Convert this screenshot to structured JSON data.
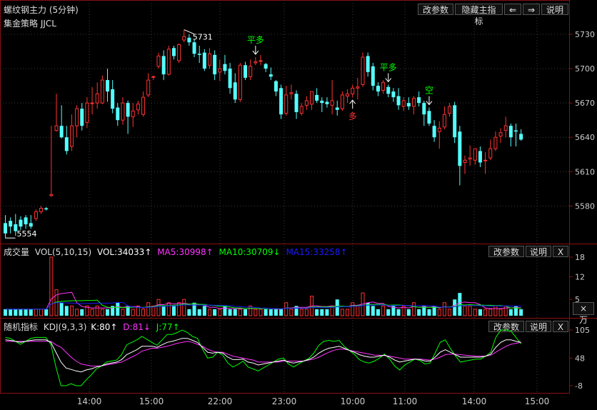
{
  "header": {
    "title": "螺纹钢主力 (5分钟)",
    "strategy": "集金策略 JJCL",
    "btn_params": "改参数",
    "btn_hide": "隐藏主指标",
    "btn_left": "⇐",
    "btn_right": "⇒",
    "btn_help": "说明"
  },
  "price_panel": {
    "y_ticks": [
      "5730",
      "5700",
      "5670",
      "5640",
      "5610",
      "5580"
    ],
    "high_label": "5731",
    "low_label": "5554",
    "signals": [
      {
        "label": "平多",
        "type": "close"
      },
      {
        "label": "多",
        "type": "long"
      },
      {
        "label": "平多",
        "type": "close"
      },
      {
        "label": "空",
        "type": "short"
      }
    ]
  },
  "volume_panel": {
    "name": "成交量",
    "vol": "VOL(5,10,15)",
    "vol_value": "VOL:34033↑",
    "ma5": "MA5:30998↑",
    "ma10": "MA10:30709↓",
    "ma15": "MA15:33258↑",
    "y_ticks": [
      "18",
      "12",
      "5"
    ],
    "unit": "×万",
    "btn_params": "改参数",
    "btn_help": "说明",
    "btn_close": "X"
  },
  "kdj_panel": {
    "name": "随机指标",
    "kdj": "KDJ(9,3,3)",
    "k": "K:80↑",
    "d": "D:81↓",
    "j": "J:77↑",
    "y_ticks": [
      "105",
      "48",
      "-8"
    ],
    "btn_params": "改参数",
    "btn_help": "说明",
    "btn_close": "X"
  },
  "x_axis": [
    "14:00",
    "15:00",
    "22:00",
    "23:00",
    "10:00",
    "11:00",
    "14:00",
    "15:00"
  ],
  "colors": {
    "up": "#ff3232",
    "down": "#54ffff",
    "ma5": "#ff33ff",
    "ma10": "#00ff00",
    "ma15": "#1a1aff",
    "signal_green": "#00ff00",
    "signal_red": "#ff3232"
  },
  "chart_data": {
    "type": "candlestick",
    "price_axis": [
      5554,
      5735
    ],
    "candles": [
      [
        5565,
        5572,
        5556,
        5552
      ],
      [
        5567,
        5570,
        5562,
        5556
      ],
      [
        5564,
        5573,
        5558,
        5554
      ],
      [
        5568,
        5571,
        5562,
        5559
      ],
      [
        5570,
        5572,
        5564,
        5560
      ],
      [
        5565,
        5572,
        5562,
        5560
      ],
      [
        5569,
        5577,
        5575,
        5567
      ],
      [
        5575,
        5580,
        5578,
        5573
      ],
      [
        5578,
        5579,
        5577,
        5576
      ],
      [
        5589,
        5650,
        5590,
        5588
      ],
      [
        5646,
        5678,
        5650,
        5645
      ],
      [
        5650,
        5668,
        5640,
        5639
      ],
      [
        5640,
        5650,
        5628,
        5625
      ],
      [
        5632,
        5660,
        5650,
        5628
      ],
      [
        5650,
        5668,
        5665,
        5640
      ],
      [
        5665,
        5670,
        5650,
        5646
      ],
      [
        5653,
        5675,
        5670,
        5648
      ],
      [
        5670,
        5684,
        5670,
        5660
      ],
      [
        5670,
        5688,
        5678,
        5665
      ],
      [
        5670,
        5694,
        5690,
        5669
      ],
      [
        5690,
        5700,
        5680,
        5671
      ],
      [
        5682,
        5690,
        5665,
        5661
      ],
      [
        5666,
        5670,
        5655,
        5650
      ],
      [
        5655,
        5675,
        5670,
        5651
      ],
      [
        5670,
        5672,
        5658,
        5643
      ],
      [
        5658,
        5670,
        5663,
        5649
      ],
      [
        5664,
        5672,
        5669,
        5660
      ],
      [
        5660,
        5680,
        5675,
        5658
      ],
      [
        5677,
        5696,
        5690,
        5675
      ],
      [
        5693,
        5694,
        5693,
        5690
      ],
      [
        5702,
        5714,
        5711,
        5700
      ],
      [
        5711,
        5716,
        5695,
        5690
      ],
      [
        5695,
        5720,
        5717,
        5694
      ],
      [
        5718,
        5720,
        5711,
        5708
      ],
      [
        5707,
        5722,
        5721,
        5705
      ],
      [
        5725,
        5734,
        5728,
        5723
      ],
      [
        5727,
        5730,
        5723,
        5720
      ],
      [
        5723,
        5726,
        5713,
        5710
      ],
      [
        5713,
        5720,
        5712,
        5705
      ],
      [
        5714,
        5717,
        5700,
        5698
      ],
      [
        5703,
        5718,
        5713,
        5700
      ],
      [
        5712,
        5716,
        5695,
        5690
      ],
      [
        5697,
        5708,
        5700,
        5689
      ],
      [
        5704,
        5712,
        5698,
        5695
      ],
      [
        5700,
        5705,
        5683,
        5678
      ],
      [
        5688,
        5696,
        5673,
        5670
      ],
      [
        5673,
        5705,
        5703,
        5671
      ],
      [
        5703,
        5706,
        5692,
        5690
      ],
      [
        5693,
        5708,
        5702,
        5690
      ],
      [
        5705,
        5710,
        5706,
        5703
      ],
      [
        5707,
        5712,
        5707,
        5703
      ],
      [
        5704,
        5705,
        5700,
        5697
      ],
      [
        5695,
        5701,
        5693,
        5690
      ],
      [
        5689,
        5690,
        5680,
        5676
      ],
      [
        5683,
        5686,
        5660,
        5656
      ],
      [
        5661,
        5685,
        5677,
        5659
      ],
      [
        5678,
        5686,
        5679,
        5673
      ],
      [
        5678,
        5681,
        5662,
        5656
      ],
      [
        5661,
        5670,
        5667,
        5659
      ],
      [
        5668,
        5676,
        5672,
        5664
      ],
      [
        5669,
        5678,
        5680,
        5664
      ],
      [
        5677,
        5683,
        5672,
        5670
      ],
      [
        5672,
        5675,
        5670,
        5662
      ],
      [
        5671,
        5675,
        5669,
        5666
      ],
      [
        5668,
        5690,
        5672,
        5660
      ],
      [
        5666,
        5672,
        5664,
        5659
      ],
      [
        5665,
        5680,
        5677,
        5663
      ],
      [
        5676,
        5682,
        5678,
        5670
      ],
      [
        5678,
        5686,
        5683,
        5675
      ],
      [
        5683,
        5692,
        5684,
        5673
      ],
      [
        5686,
        5714,
        5710,
        5684
      ],
      [
        5711,
        5714,
        5697,
        5693
      ],
      [
        5702,
        5705,
        5685,
        5681
      ],
      [
        5685,
        5688,
        5680,
        5676
      ],
      [
        5681,
        5690,
        5688,
        5678
      ],
      [
        5684,
        5686,
        5678,
        5675
      ],
      [
        5680,
        5683,
        5675,
        5671
      ],
      [
        5676,
        5683,
        5668,
        5664
      ],
      [
        5667,
        5675,
        5672,
        5663
      ],
      [
        5670,
        5675,
        5667,
        5664
      ],
      [
        5667,
        5676,
        5674,
        5660
      ],
      [
        5675,
        5680,
        5670,
        5667
      ],
      [
        5670,
        5672,
        5660,
        5650
      ],
      [
        5663,
        5666,
        5652,
        5650
      ],
      [
        5650,
        5655,
        5640,
        5636
      ],
      [
        5645,
        5654,
        5648,
        5630
      ],
      [
        5649,
        5667,
        5660,
        5647
      ],
      [
        5661,
        5670,
        5667,
        5658
      ],
      [
        5668,
        5671,
        5640,
        5635
      ],
      [
        5645,
        5650,
        5615,
        5598
      ],
      [
        5618,
        5624,
        5620,
        5608
      ],
      [
        5621,
        5633,
        5622,
        5615
      ],
      [
        5620,
        5629,
        5630,
        5616
      ],
      [
        5628,
        5632,
        5618,
        5614
      ],
      [
        5620,
        5627,
        5620,
        5608
      ],
      [
        5622,
        5638,
        5630,
        5620
      ],
      [
        5630,
        5645,
        5640,
        5628
      ],
      [
        5641,
        5648,
        5644,
        5635
      ],
      [
        5646,
        5658,
        5650,
        5640
      ],
      [
        5650,
        5652,
        5640,
        5632
      ],
      [
        5646,
        5652,
        5645,
        5632
      ],
      [
        5643,
        5647,
        5638,
        5637
      ]
    ],
    "volume_axis": [
      0,
      18
    ],
    "volume_unit": "万",
    "volume": [
      2,
      2,
      2,
      2,
      2,
      2,
      2,
      2,
      2,
      18,
      8,
      4,
      3,
      3,
      2,
      2,
      3,
      2,
      3,
      2,
      2,
      3,
      4,
      2,
      3,
      2,
      3,
      2,
      4,
      3,
      5,
      3,
      4,
      3,
      4,
      5,
      2,
      4,
      2,
      3,
      2,
      2,
      2,
      3,
      2,
      2,
      2,
      2,
      3,
      2,
      2,
      2,
      2,
      2,
      2,
      4,
      2,
      3,
      2,
      2,
      6,
      2,
      2,
      2,
      3,
      5,
      2,
      2,
      4,
      3,
      7,
      4,
      3,
      2,
      3,
      2,
      3,
      2,
      3,
      2,
      4,
      2,
      3,
      2,
      3,
      2,
      4,
      2,
      5,
      7,
      3,
      3,
      2,
      2,
      2,
      2,
      3,
      2,
      3,
      2,
      3,
      2
    ],
    "kdj_axis": [
      -8,
      105
    ],
    "kdj_K": [
      85,
      84,
      82,
      80,
      82,
      84,
      85,
      85,
      85,
      80,
      60,
      40,
      28,
      25,
      22,
      20,
      24,
      26,
      30,
      32,
      36,
      38,
      40,
      45,
      55,
      60,
      65,
      72,
      72,
      72,
      70,
      75,
      80,
      82,
      85,
      88,
      88,
      84,
      80,
      70,
      60,
      58,
      60,
      58,
      50,
      45,
      45,
      46,
      40,
      38,
      34,
      36,
      38,
      40,
      42,
      44,
      40,
      38,
      40,
      42,
      45,
      50,
      58,
      64,
      68,
      70,
      72,
      68,
      64,
      60,
      55,
      52,
      50,
      50,
      52,
      54,
      50,
      44,
      40,
      42,
      44,
      46,
      45,
      42,
      42,
      50,
      60,
      65,
      60,
      55,
      50,
      50,
      50,
      50,
      50,
      52,
      56,
      70,
      80,
      85,
      85,
      82,
      80
    ],
    "kdj_D": [
      82,
      82,
      82,
      82,
      82,
      82,
      82,
      82,
      82,
      82,
      75,
      70,
      60,
      50,
      42,
      36,
      34,
      32,
      32,
      32,
      34,
      36,
      38,
      40,
      45,
      50,
      55,
      62,
      65,
      68,
      68,
      70,
      72,
      75,
      78,
      80,
      82,
      80,
      76,
      72,
      66,
      62,
      60,
      60,
      56,
      52,
      50,
      48,
      46,
      44,
      40,
      40,
      40,
      40,
      40,
      42,
      42,
      42,
      42,
      42,
      44,
      46,
      50,
      55,
      60,
      64,
      66,
      66,
      64,
      62,
      60,
      58,
      56,
      54,
      54,
      53,
      52,
      50,
      48,
      46,
      46,
      46,
      46,
      45,
      44,
      46,
      50,
      55,
      56,
      56,
      55,
      54,
      53,
      52,
      52,
      52,
      54,
      60,
      66,
      72,
      76,
      78,
      80
    ],
    "kdj_J": [
      90,
      88,
      82,
      76,
      82,
      88,
      90,
      90,
      90,
      76,
      30,
      -20,
      -30,
      -4,
      -20,
      -10,
      4,
      14,
      26,
      32,
      40,
      42,
      44,
      55,
      75,
      80,
      85,
      92,
      86,
      80,
      74,
      85,
      96,
      96,
      100,
      105,
      100,
      92,
      88,
      66,
      48,
      50,
      60,
      54,
      38,
      30,
      35,
      42,
      30,
      26,
      22,
      28,
      34,
      40,
      46,
      48,
      36,
      30,
      36,
      42,
      47,
      58,
      74,
      82,
      84,
      82,
      84,
      72,
      64,
      56,
      45,
      40,
      38,
      42,
      48,
      56,
      46,
      32,
      24,
      34,
      40,
      46,
      43,
      36,
      38,
      58,
      80,
      85,
      68,
      53,
      40,
      42,
      44,
      46,
      46,
      52,
      60,
      90,
      108,
      111,
      103,
      90,
      77
    ]
  }
}
